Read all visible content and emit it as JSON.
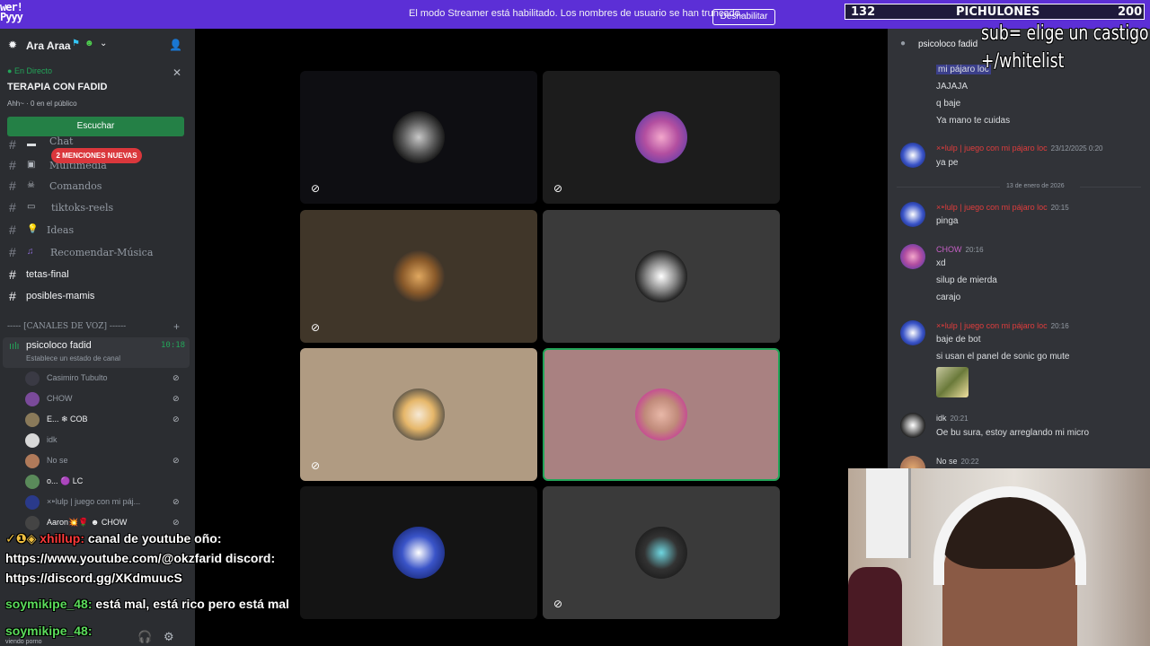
{
  "banner": {
    "logo_text": "wer!\nPyyy",
    "message": "El modo Streamer está habilitado. Los nombres de usuario se han truncado.",
    "disable_label": "Deshabilitar"
  },
  "counter": {
    "left": "132",
    "label": "PICHULONES",
    "right": "200"
  },
  "server": {
    "name": "Ara Araa"
  },
  "stage": {
    "live_label": "En Directo",
    "title": "TERAPIA CON FADID",
    "meta": "Ahh~ · 0 en el público",
    "listen_label": "Escuchar"
  },
  "channels": [
    {
      "name": "Chat"
    },
    {
      "name": "Multimedia"
    },
    {
      "name": "Comandos"
    },
    {
      "name": "tiktoks-reels"
    },
    {
      "name": "Ideas"
    },
    {
      "name": "Recomendar-Música"
    },
    {
      "name": "tetas-final"
    },
    {
      "name": "posibles-mamis"
    }
  ],
  "mentions_badge": "2 MENCIONES NUEVAS",
  "voice_category": "----- [CANALES DE VOZ] ------",
  "voice_channel": {
    "name": "psicoloco fadid",
    "status": "Establece un estado de canal",
    "time": "10:18"
  },
  "voice_users": [
    {
      "name": "Casimiro Tubulto"
    },
    {
      "name": "CHOW"
    },
    {
      "name": "E... ❄ COB"
    },
    {
      "name": "idk"
    },
    {
      "name": "No se"
    },
    {
      "name": "o... 🟣 LC"
    },
    {
      "name": "×⁍lulp | juego con mi páj..."
    },
    {
      "name": "Aaron💥🌹 ☻ CHOW"
    }
  ],
  "overlay": {
    "user1": "xhillup:",
    "msg1": " canal de youtube oño:",
    "msg1b": "https://www.youtube.com/@okzfarid discord:",
    "msg1c": "https://discord.gg/XKdmuucS",
    "user2": "soymikipe_48:",
    "msg2": " está mal, está rico pero está mal",
    "user3": "soymikipe_48:",
    "footer_small": "viendo porno"
  },
  "chat": {
    "header": "psicoloco fadid",
    "messages": [
      {
        "text": "mi pájaro loc"
      },
      {
        "text": "JAJAJA"
      },
      {
        "text": "q baje"
      },
      {
        "text": "Ya mano te cuidas"
      },
      {
        "author": "×⁍lulp | juego con mi pájaro loc",
        "ts": "23/12/2025 0:20",
        "text": "ya pe"
      },
      {
        "date": "13 de enero de 2026"
      },
      {
        "author": "×⁍lulp | juego con mi pájaro loc",
        "ts": "20:15",
        "text": "pinga"
      },
      {
        "author": "CHOW",
        "ts": "20:16",
        "text": "xd",
        "text2": "silup de mierda",
        "text3": "carajo"
      },
      {
        "author": "×⁍lulp | juego con mi pájaro loc",
        "ts": "20:16",
        "text": "baje de bot",
        "text2": "si usan el panel de sonic go mute"
      },
      {
        "author": "idk",
        "ts": "20:21",
        "text": "Oe bu sura, estoy arreglando mi micro"
      },
      {
        "author": "No se",
        "ts": "20:22"
      }
    ]
  },
  "sub_overlay": {
    "line1": "sub= elige un castigo",
    "line2": "+/whitelist"
  },
  "colors": {
    "accent": "#5c2fd6",
    "green": "#23a559",
    "red": "#da373c"
  },
  "tiles_muted_icon": "mic-muted-icon"
}
